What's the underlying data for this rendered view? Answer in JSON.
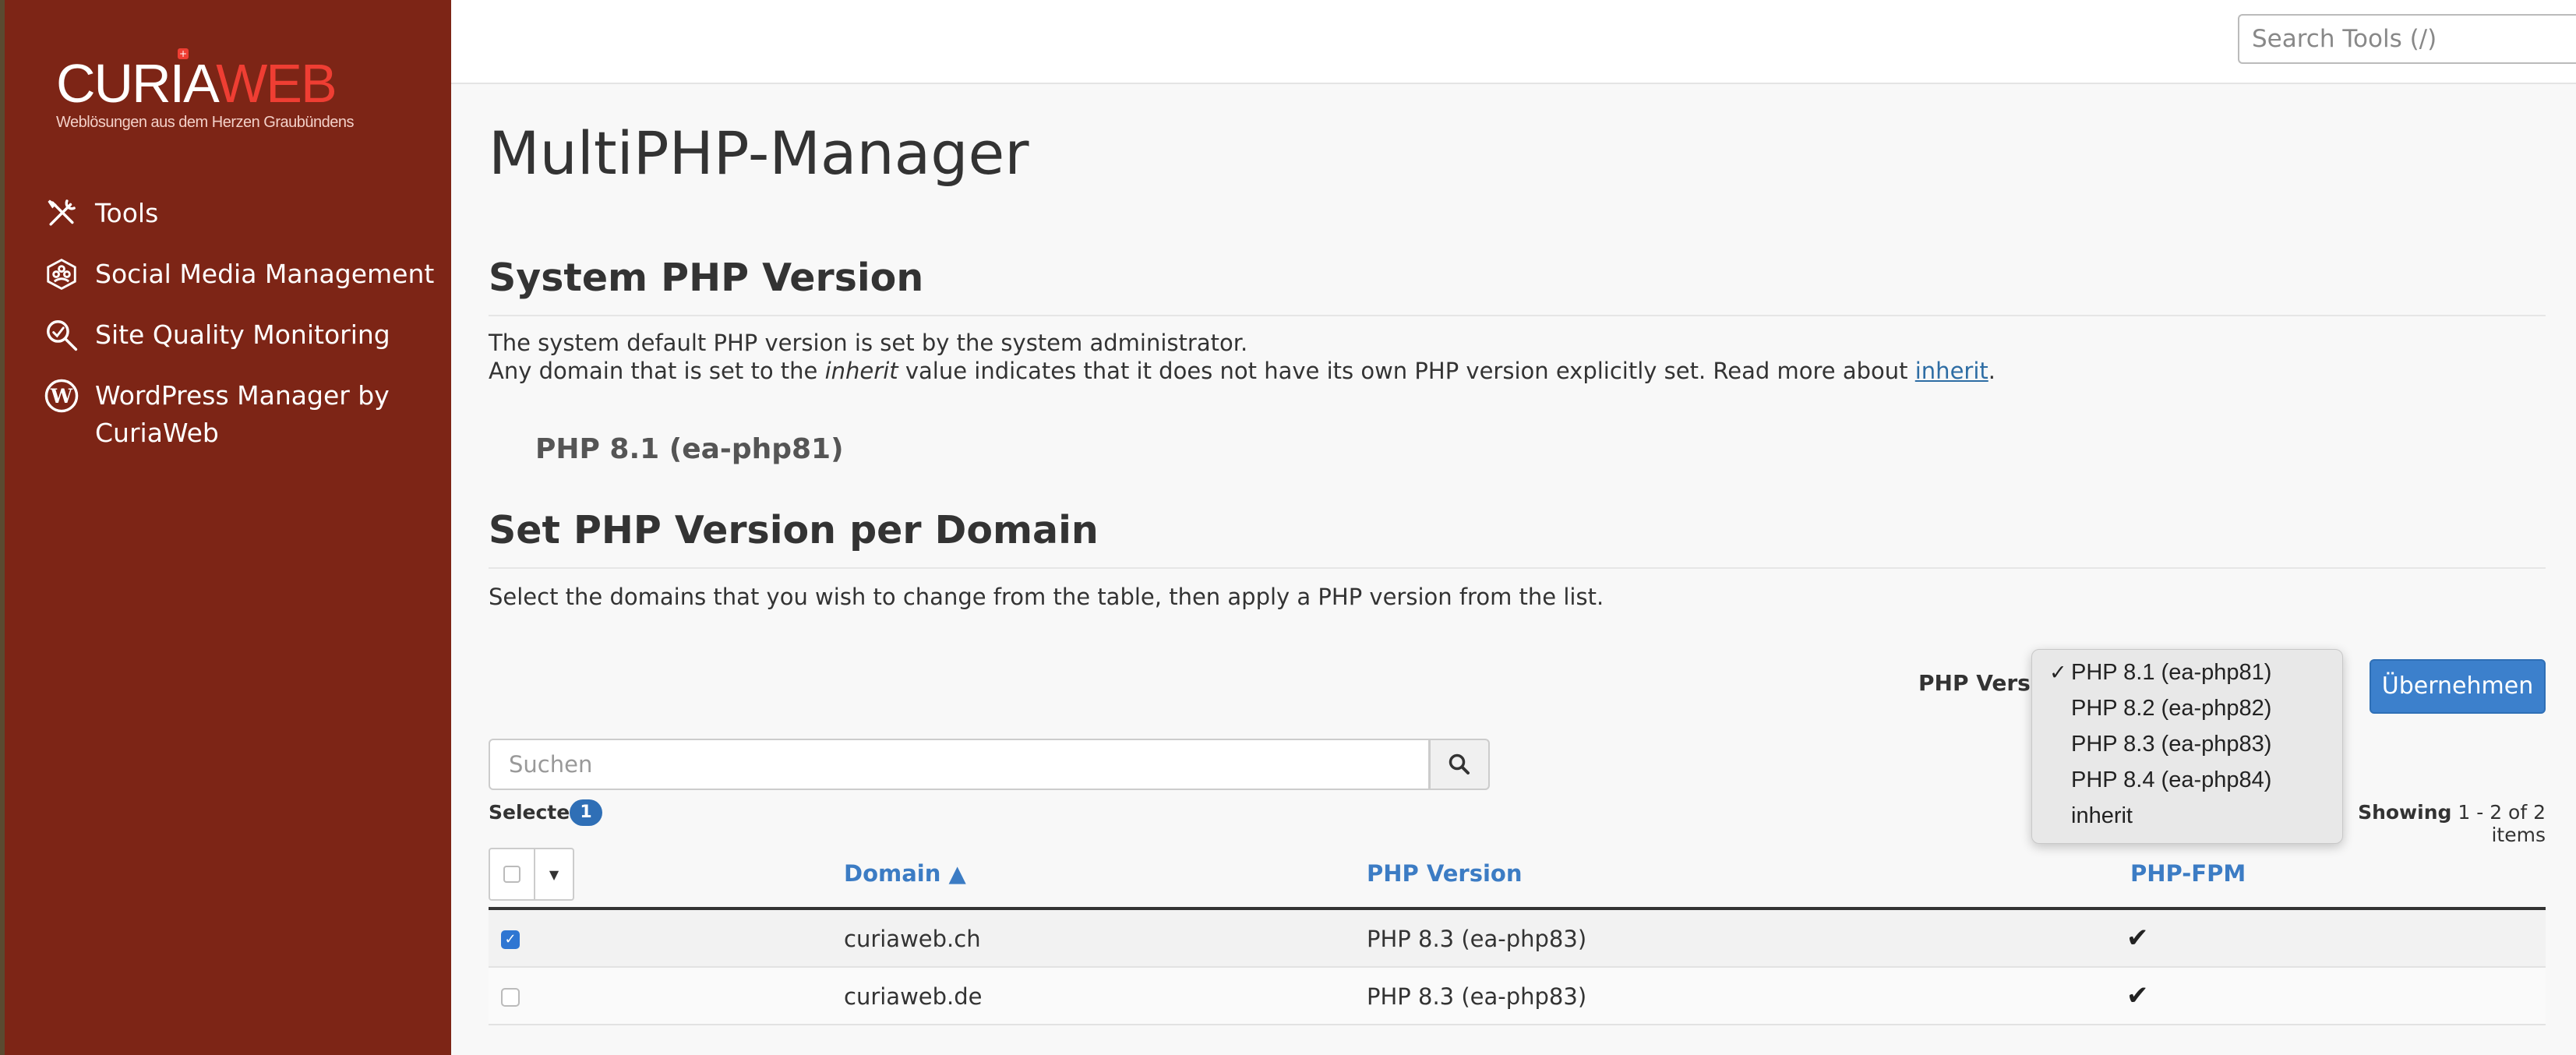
{
  "brand": {
    "name_part1": "CURIA",
    "name_part2": "WEB",
    "tagline": "Weblösungen aus dem Herzen Graubündens",
    "colors": {
      "sidebar": "#7d2516",
      "accent_red": "#ef3e33",
      "link_blue": "#3c7cc4",
      "button_blue": "#3c80cc"
    }
  },
  "sidebar": {
    "items": [
      {
        "label": "Tools",
        "icon": "tools-icon"
      },
      {
        "label": "Social Media Management",
        "icon": "social-media-icon"
      },
      {
        "label": "Site Quality Monitoring",
        "icon": "magnifier-icon"
      },
      {
        "label": "WordPress Manager by CuriaWeb",
        "icon": "wordpress-icon"
      }
    ]
  },
  "topbar": {
    "search_placeholder": "Search Tools (/)"
  },
  "page": {
    "title": "MultiPHP-Manager",
    "system_section": {
      "title": "System PHP Version",
      "line1": "The system default PHP version is set by the system administrator.",
      "line2_pre": "Any domain that is set to the ",
      "line2_em": "inherit",
      "line2_mid": " value indicates that it does not have its own PHP version explicitly set. Read more about ",
      "line2_link": "inherit",
      "line2_post": ".",
      "current_version": "PHP 8.1 (ea-php81)"
    },
    "domain_section": {
      "title": "Set PHP Version per Domain",
      "description": "Select the domains that you wish to change from the table, then apply a PHP version from the list."
    }
  },
  "controls": {
    "php_version_label": "PHP Version",
    "apply_button": "Übernehmen",
    "dropdown": {
      "selected_index": 0,
      "options": [
        "PHP 8.1 (ea-php81)",
        "PHP 8.2 (ea-php82)",
        "PHP 8.3 (ea-php83)",
        "PHP 8.4 (ea-php84)",
        "inherit"
      ]
    },
    "search_placeholder": "Suchen",
    "selected_label": "Selected",
    "selected_count": "1",
    "showing_prefix": "Showing",
    "showing_range": "1 - 2 of 2 items"
  },
  "table": {
    "headers": {
      "domain": "Domain ▲",
      "php_version": "PHP Version",
      "php_fpm": "PHP-FPM"
    },
    "rows": [
      {
        "checked": true,
        "domain": "curiaweb.ch",
        "php_version": "PHP 8.3 (ea-php83)",
        "php_fpm": "✔"
      },
      {
        "checked": false,
        "domain": "curiaweb.de",
        "php_version": "PHP 8.3 (ea-php83)",
        "php_fpm": "✔"
      }
    ]
  }
}
